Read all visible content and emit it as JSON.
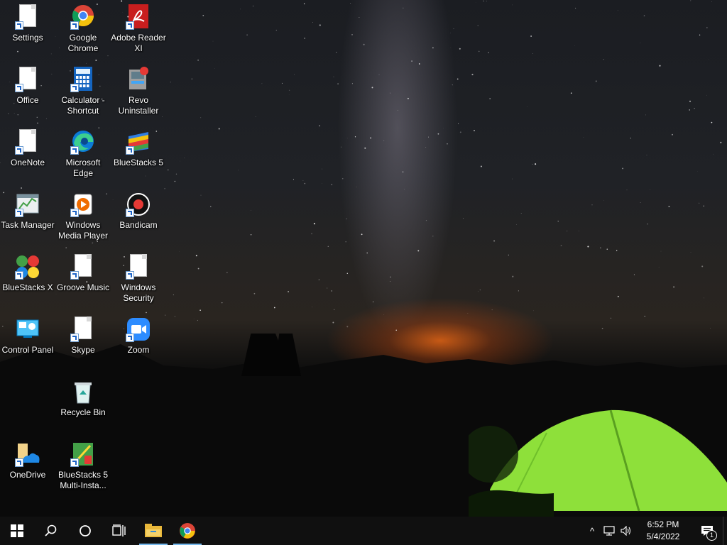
{
  "desktop": {
    "icons": [
      {
        "label": "Settings",
        "icon": "settings-doc-icon"
      },
      {
        "label": "Google Chrome",
        "icon": "chrome-icon"
      },
      {
        "label": "Adobe Reader XI",
        "icon": "adobe-reader-icon"
      },
      {
        "label": "Office",
        "icon": "office-doc-icon"
      },
      {
        "label": "Calculator - Shortcut",
        "icon": "calculator-icon"
      },
      {
        "label": "Revo Uninstaller",
        "icon": "revo-uninstaller-icon"
      },
      {
        "label": "OneNote",
        "icon": "onenote-doc-icon"
      },
      {
        "label": "Microsoft Edge",
        "icon": "edge-icon"
      },
      {
        "label": "BlueStacks 5",
        "icon": "bluestacks-icon"
      },
      {
        "label": "Task Manager",
        "icon": "task-manager-icon"
      },
      {
        "label": "Windows Media Player",
        "icon": "media-player-icon"
      },
      {
        "label": "Bandicam",
        "icon": "bandicam-icon"
      },
      {
        "label": "BlueStacks X",
        "icon": "bluestacks-x-icon"
      },
      {
        "label": "Groove Music",
        "icon": "groove-music-doc-icon"
      },
      {
        "label": "Windows Security",
        "icon": "windows-security-doc-icon"
      },
      {
        "label": "Control Panel",
        "icon": "control-panel-icon"
      },
      {
        "label": "Skype",
        "icon": "skype-doc-icon"
      },
      {
        "label": "Zoom",
        "icon": "zoom-icon"
      },
      {
        "label": "Recycle Bin",
        "icon": "recycle-bin-icon"
      },
      {
        "label": "OneDrive",
        "icon": "onedrive-icon"
      },
      {
        "label": "BlueStacks 5 Multi-Insta...",
        "icon": "bluestacks-multi-instance-icon"
      }
    ]
  },
  "taskbar": {
    "start": "start-icon",
    "search": "search-icon",
    "cortana": "cortana-icon",
    "task_view": "task-view-icon",
    "pinned": [
      {
        "name": "File Explorer",
        "icon": "file-explorer-icon",
        "active": true
      },
      {
        "name": "Google Chrome",
        "icon": "chrome-icon",
        "active": true
      }
    ],
    "tray": {
      "chevron": "^",
      "time": "6:52 PM",
      "date": "5/4/2022",
      "notification_count": "1"
    }
  },
  "colors": {
    "taskbar_bg": "#101010",
    "active_indicator": "#76b9ed",
    "tent_green": "#8ee03a"
  }
}
